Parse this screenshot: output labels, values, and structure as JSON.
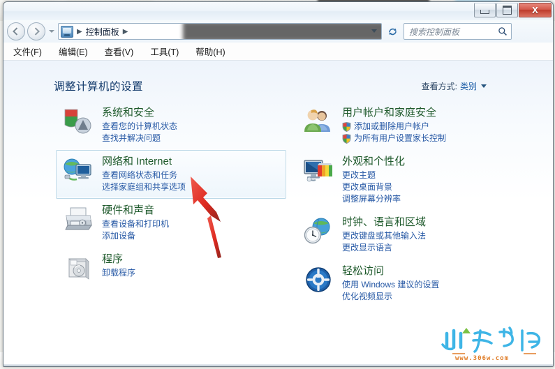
{
  "window": {
    "title": "",
    "buttons": {
      "minimize": "–",
      "maximize": "□",
      "close": "X"
    }
  },
  "address_bar": {
    "back_tooltip": "后退",
    "forward_tooltip": "前进",
    "breadcrumb": [
      "控制面板"
    ],
    "icon": "control-panel-icon",
    "refresh_icon": "refresh-icon",
    "dropdown_icon": "chevron-down-icon"
  },
  "search": {
    "placeholder": "搜索控制面板",
    "value": "",
    "icon": "search-icon"
  },
  "menubar": {
    "items": [
      {
        "label": "文件(F)"
      },
      {
        "label": "编辑(E)"
      },
      {
        "label": "查看(V)"
      },
      {
        "label": "工具(T)"
      },
      {
        "label": "帮助(H)"
      }
    ]
  },
  "content": {
    "page_title": "调整计算机的设置",
    "view_by": {
      "label": "查看方式:",
      "value": "类别"
    }
  },
  "categories": {
    "left": [
      {
        "id": "system-and-security",
        "icon": "shield-security-icon",
        "title": "系统和安全",
        "links": [
          {
            "text": "查看您的计算机状态",
            "shield": false
          },
          {
            "text": "查找并解决问题",
            "shield": false
          }
        ],
        "selected": false
      },
      {
        "id": "network-and-internet",
        "icon": "globe-monitor-icon",
        "title": "网络和 Internet",
        "links": [
          {
            "text": "查看网络状态和任务",
            "shield": false
          },
          {
            "text": "选择家庭组和共享选项",
            "shield": false
          }
        ],
        "selected": true
      },
      {
        "id": "hardware-and-sound",
        "icon": "printer-icon",
        "title": "硬件和声音",
        "links": [
          {
            "text": "查看设备和打印机",
            "shield": false
          },
          {
            "text": "添加设备",
            "shield": false
          }
        ],
        "selected": false
      },
      {
        "id": "programs",
        "icon": "programs-disc-icon",
        "title": "程序",
        "links": [
          {
            "text": "卸载程序",
            "shield": false
          }
        ],
        "selected": false
      }
    ],
    "right": [
      {
        "id": "user-accounts-family-safety",
        "icon": "users-icon",
        "title": "用户帐户和家庭安全",
        "links": [
          {
            "text": "添加或删除用户帐户",
            "shield": true
          },
          {
            "text": "为所有用户设置家长控制",
            "shield": true
          }
        ],
        "selected": false
      },
      {
        "id": "appearance-personalization",
        "icon": "monitor-palette-icon",
        "title": "外观和个性化",
        "links": [
          {
            "text": "更改主题",
            "shield": false
          },
          {
            "text": "更改桌面背景",
            "shield": false
          },
          {
            "text": "调整屏幕分辨率",
            "shield": false
          }
        ],
        "selected": false
      },
      {
        "id": "clock-language-region",
        "icon": "clock-globe-icon",
        "title": "时钟、语言和区域",
        "links": [
          {
            "text": "更改键盘或其他输入法",
            "shield": false
          },
          {
            "text": "更改显示语言",
            "shield": false
          }
        ],
        "selected": false
      },
      {
        "id": "ease-of-access",
        "icon": "ease-of-access-icon",
        "title": "轻松访问",
        "links": [
          {
            "text": "使用 Windows 建议的设置",
            "shield": false
          },
          {
            "text": "优化视频显示",
            "shield": false
          }
        ],
        "selected": false
      }
    ]
  },
  "annotation": {
    "arrow_color": "#e03127",
    "arrow_target": "network-and-internet"
  },
  "watermark": {
    "url": "www.306w.com",
    "logo_color": "#3eb5e6",
    "accent_color": "#7ac143"
  }
}
